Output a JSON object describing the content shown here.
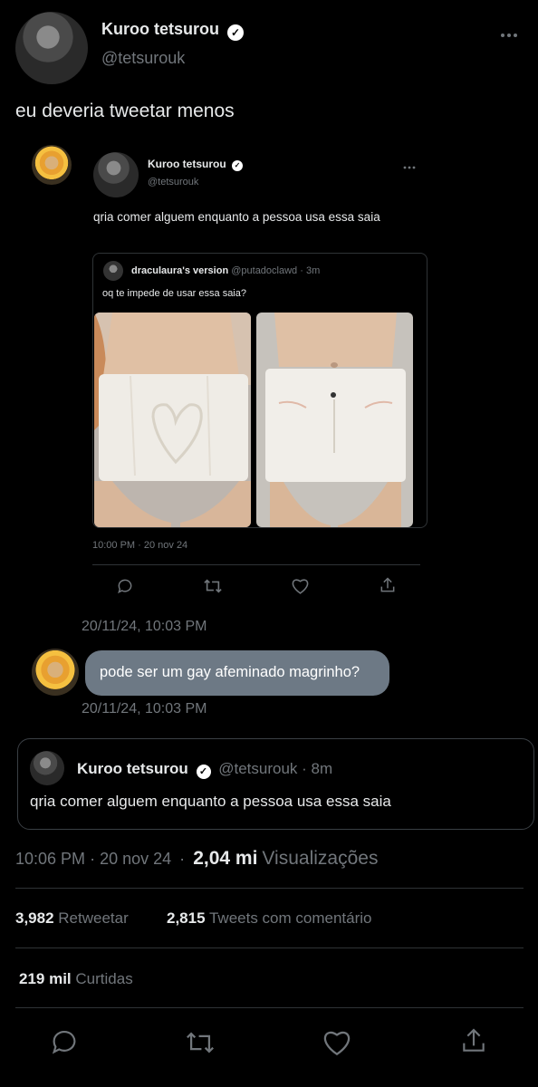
{
  "author": {
    "name": "Kuroo tetsurou",
    "handle": "@tetsurouk"
  },
  "tweet_text": "eu deveria tweetar menos",
  "screenshot": {
    "inner_author_name": "Kuroo tetsurou",
    "inner_author_handle": "@tetsurouk",
    "inner_text": "qria comer alguem enquanto a pessoa usa essa saia",
    "quoted": {
      "name": "draculaura's version",
      "handle": "@putadoclawd",
      "age": "· 3m",
      "text": "oq te impede de usar essa saia?"
    },
    "inner_timestamp": "10:00 PM · 20 nov 24",
    "chat_timestamp_1": "20/11/24, 10:03 PM",
    "chat_message": "pode ser um gay afeminado magrinho?",
    "chat_timestamp_2": "20/11/24, 10:03 PM"
  },
  "quote_card": {
    "name": "Kuroo tetsurou",
    "handle": "@tetsurouk",
    "age": "· 8m",
    "text": "qria comer alguem enquanto a pessoa usa essa saia"
  },
  "meta": {
    "time": "10:06 PM",
    "sep1": "·",
    "date": "20 nov 24",
    "sep2": "·",
    "views_count": "2,04 mi",
    "views_label": "Visualizações"
  },
  "stats": {
    "retweets_count": "3,982",
    "retweets_label": "Retweetar",
    "quotes_count": "2,815",
    "quotes_label": "Tweets com comentário",
    "likes_count": "219 mil",
    "likes_label": "Curtidas"
  },
  "icons": {
    "reply": "reply-icon",
    "retweet": "retweet-icon",
    "like": "like-icon",
    "share": "share-icon",
    "more": "more-icon",
    "verified": "verified-icon"
  }
}
